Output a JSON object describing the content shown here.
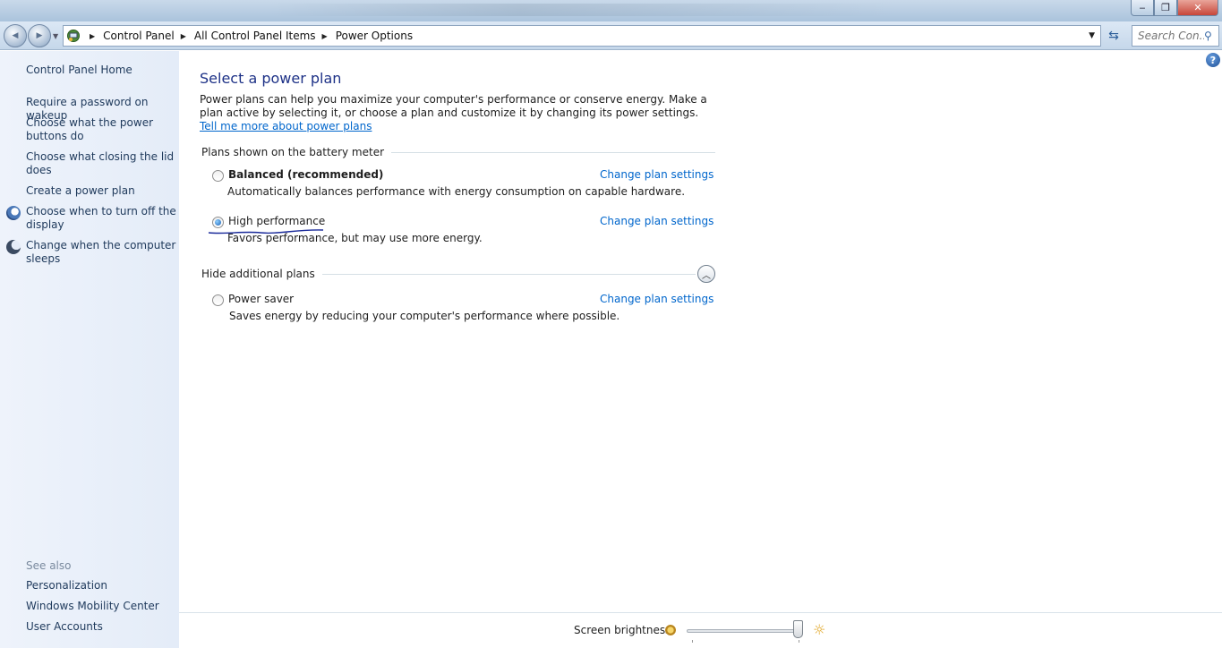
{
  "window": {
    "buttons": {
      "minimize": "‒",
      "maximize": "❐",
      "close": "✕"
    }
  },
  "address_bar": {
    "back_glyph": "◀",
    "forward_glyph": "▶",
    "breadcrumbs": [
      "Control Panel",
      "All Control Panel Items",
      "Power Options"
    ],
    "search_placeholder": "Search Con..."
  },
  "sidebar": {
    "home": "Control Panel Home",
    "links": [
      {
        "label": "Require a password on wakeup",
        "icon": ""
      },
      {
        "label": "Choose what the power buttons do",
        "icon": ""
      },
      {
        "label": "Choose what closing the lid does",
        "icon": ""
      },
      {
        "label": "Create a power plan",
        "icon": ""
      },
      {
        "label": "Choose when to turn off the display",
        "icon": "clock-icon"
      },
      {
        "label": "Change when the computer sleeps",
        "icon": "moon-icon"
      }
    ],
    "see_also_title": "See also",
    "see_also": [
      "Personalization",
      "Windows Mobility Center",
      "User Accounts"
    ]
  },
  "main": {
    "title": "Select a power plan",
    "intro_text": "Power plans can help you maximize your computer's performance or conserve energy. Make a plan active by selecting it, or choose a plan and customize it by changing its power settings. ",
    "intro_link": "Tell me more about power plans",
    "group_battery": "Plans shown on the battery meter",
    "group_additional": "Hide additional plans",
    "plans": [
      {
        "name": "Balanced (recommended)",
        "description": "Automatically balances performance with energy consumption on capable hardware.",
        "selected": false,
        "link": "Change plan settings"
      },
      {
        "name": "High performance",
        "description": "Favors performance, but may use more energy.",
        "selected": true,
        "link": "Change plan settings"
      },
      {
        "name": "Power saver",
        "description": "Saves energy by reducing your computer's performance where possible.",
        "selected": false,
        "link": "Change plan settings"
      }
    ]
  },
  "bottom": {
    "brightness_label": "Screen brightness:",
    "brightness_level": 1.0
  },
  "colors": {
    "link": "#0066cc",
    "title": "#1e3287",
    "sidebar_link": "#1e395b",
    "annotation_scribble": "#1a2a9a"
  }
}
